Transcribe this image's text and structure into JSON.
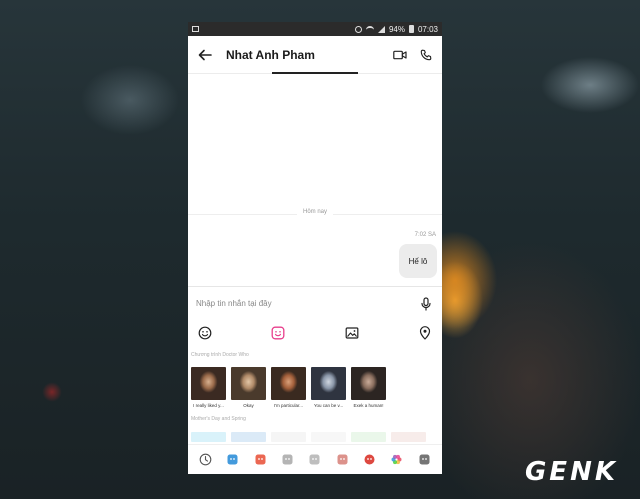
{
  "status_bar": {
    "battery": "94%",
    "time": "07:03",
    "icons": [
      "image-icon",
      "alarm-icon",
      "wifi-icon",
      "signal-icon",
      "battery-icon"
    ]
  },
  "header": {
    "title": "Nhat Anh Pham",
    "icons": [
      "back-arrow-icon",
      "video-call-icon",
      "phone-icon"
    ]
  },
  "chat": {
    "date_label": "Hôm nay",
    "messages": [
      {
        "time": "7:02 SA",
        "text": "Hế lô",
        "side": "outgoing"
      }
    ]
  },
  "composer": {
    "placeholder": "Nhập tin nhắn tại đây",
    "icons": [
      "microphone-icon"
    ]
  },
  "toolbar": {
    "icons": [
      "emoji-icon",
      "sticker-icon",
      "gallery-icon",
      "location-icon"
    ],
    "active": "sticker-icon",
    "accent": "#e83e8c"
  },
  "sticker_sections": [
    {
      "title": "Chương trình Doctor Who",
      "stickers": [
        {
          "caption": "I really liked y...",
          "colors": [
            "#3b2a22",
            "#9a6a4a",
            "#d7b08f"
          ]
        },
        {
          "caption": "Okay",
          "colors": [
            "#4a3a2c",
            "#b08a68",
            "#e2c6a6"
          ]
        },
        {
          "caption": "I'm particular...",
          "colors": [
            "#3a2a20",
            "#a35f3a",
            "#d9a07a"
          ]
        },
        {
          "caption": "You can be v...",
          "colors": [
            "#2f3440",
            "#8a96a8",
            "#cfd6e0"
          ]
        },
        {
          "caption": "Exek a human!",
          "colors": [
            "#2c2522",
            "#8a6e5e",
            "#c9ab98"
          ]
        }
      ]
    },
    {
      "title": "Mother's Day and Spring",
      "stickers": [
        {
          "caption": ""
        },
        {
          "caption": ""
        },
        {
          "caption": ""
        },
        {
          "caption": ""
        },
        {
          "caption": ""
        },
        {
          "caption": ""
        }
      ]
    }
  ],
  "tab_bar": {
    "icons": [
      "recent-clock-icon",
      "sticker-pack-1-icon",
      "sticker-pack-2-icon",
      "sticker-pack-3-icon",
      "sticker-pack-4-icon",
      "sticker-pack-5-icon",
      "angry-bird-icon",
      "flower-icon",
      "sticker-pack-8-icon"
    ],
    "colors": [
      "#555555",
      "#2f8fd8",
      "#e9573f",
      "#777777",
      "#888888",
      "#c0392b",
      "#d9342b",
      "#b565d8",
      "#666666"
    ]
  },
  "watermark": {
    "text": "GEN",
    "accent_text": "K"
  }
}
